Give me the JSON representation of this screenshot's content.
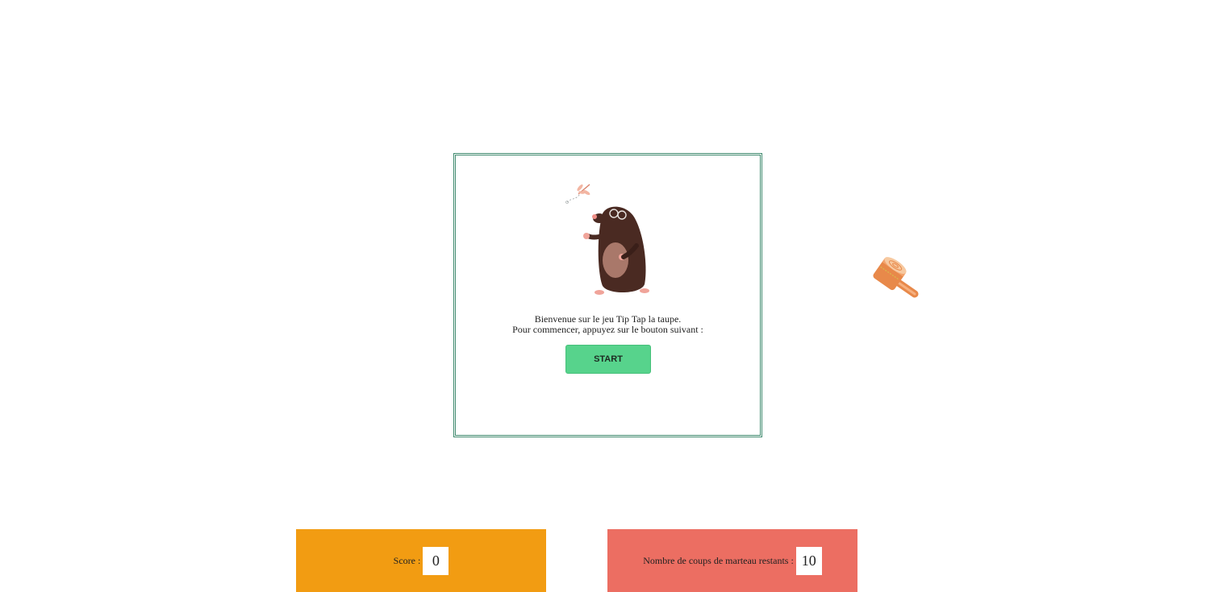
{
  "welcome": {
    "line1": "Bienvenue sur le jeu Tip Tap la taupe.",
    "line2": "Pour commencer, appuyez sur le bouton suivant :",
    "start_label": "START"
  },
  "score": {
    "label": "Score :",
    "value": "0"
  },
  "hits": {
    "label": "Nombre de coups de marteau restants :",
    "value": "10"
  },
  "colors": {
    "score_panel": "#f29c12",
    "hits_panel": "#ec6e62",
    "start_button": "#57d38c",
    "dialog_border": "#3f8a6e"
  },
  "icons": {
    "mascot": "mole-icon",
    "cursor": "hammer-icon"
  }
}
